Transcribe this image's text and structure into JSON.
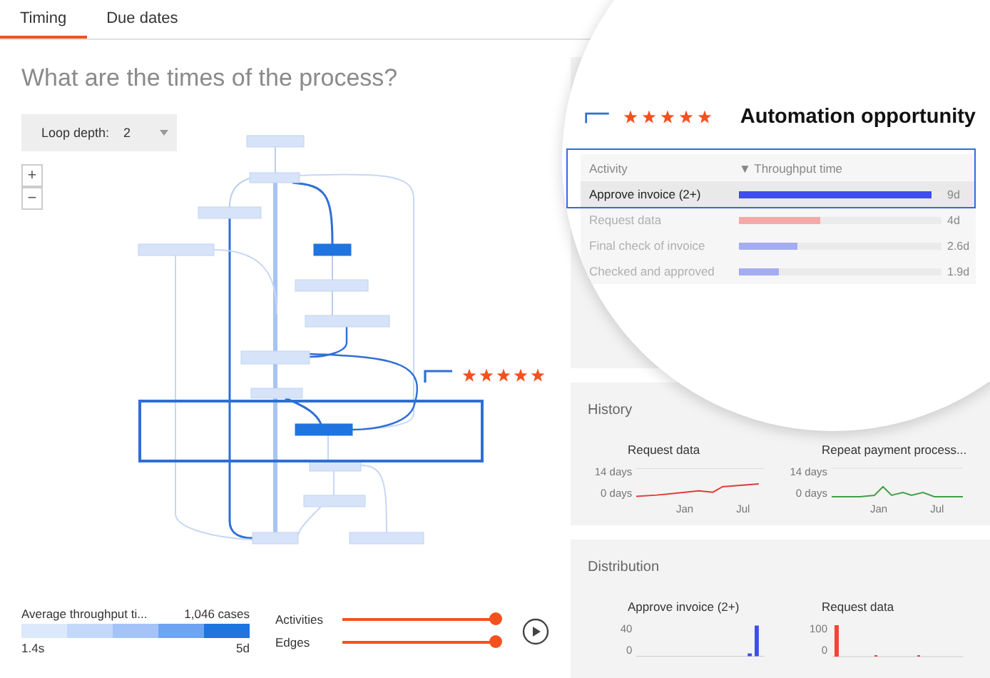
{
  "tabs": [
    {
      "label": "Timing",
      "selected": true
    },
    {
      "label": "Due dates",
      "selected": false
    }
  ],
  "title": "What are the times of the process?",
  "loop_depth": {
    "label": "Loop depth:",
    "value": "2"
  },
  "zoom_buttons": [
    "+",
    "−"
  ],
  "process_map": {
    "stars": 5
  },
  "legend": {
    "label": "Average throughput ti...",
    "cases": "1,046 cases",
    "min": "1.4s",
    "max": "5d"
  },
  "sliders": [
    {
      "label": "Activities",
      "level": 1
    },
    {
      "label": "Edges",
      "level": 1
    }
  ],
  "opportunity": {
    "stars": 5,
    "title": "Automation opportunity",
    "columns": [
      "Activity",
      "▼ Throughput time"
    ],
    "rows": [
      {
        "activity": "Approve invoice (2+)",
        "level": 0.95,
        "value": "9d",
        "color": "#3d4fe8",
        "highlighted": true
      },
      {
        "activity": "Request data",
        "level": 0.4,
        "value": "4d",
        "color": "#f4a9a8",
        "highlighted": false
      },
      {
        "activity": "Final check of invoice",
        "level": 0.29,
        "value": "2.6d",
        "color": "#a4acf2",
        "highlighted": false
      },
      {
        "activity": "Checked and approved",
        "level": 0.2,
        "value": "1.9d",
        "color": "#a4acf2",
        "highlighted": false
      }
    ]
  },
  "history": {
    "title": "History",
    "charts": [
      {
        "title": "Request data",
        "yticks": [
          "14 days",
          "0 days"
        ],
        "xticks": [
          "Jan",
          "Jul"
        ],
        "color": "#e53935"
      },
      {
        "title": "Repeat payment process...",
        "yticks": [
          "14 days",
          "0 days"
        ],
        "xticks": [
          "Jan",
          "Jul"
        ],
        "color": "#43a047"
      }
    ]
  },
  "distribution": {
    "title": "Distribution",
    "charts": [
      {
        "title": "Approve invoice (2+)",
        "yticks": [
          "40",
          "0"
        ],
        "color": "#3d4fe8"
      },
      {
        "title": "Request data",
        "yticks": [
          "100",
          "0"
        ],
        "color": "#f44336"
      }
    ]
  }
}
